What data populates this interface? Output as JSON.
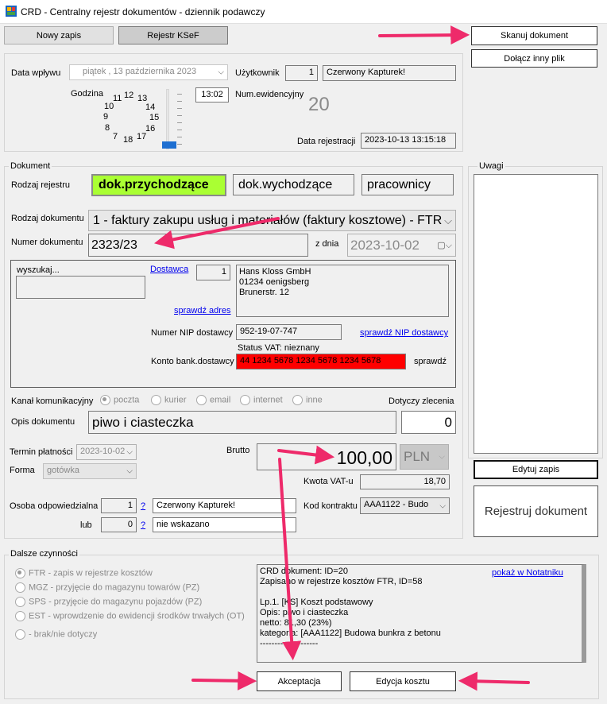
{
  "window": {
    "title": "CRD - Centralny rejestr dokumentów - dziennik podawczy"
  },
  "toolbar": {
    "new_entry": "Nowy zapis",
    "ksef": "Rejestr KSeF",
    "scan": "Skanuj dokument",
    "attach": "Dołącz inny plik"
  },
  "receipt": {
    "date_label": "Data wpływu",
    "date_value": "piątek     , 13 października 2023",
    "user_label": "Użytkownik",
    "user_id": "1",
    "user_name": "Czerwony Kapturek!",
    "hour_label": "Godzina",
    "time_value": "13:02",
    "evid_label": "Num.ewidencyjny",
    "evid_value": "20",
    "regdate_label": "Data rejestracji",
    "regdate_value": "2023-10-13 13:15:18",
    "clock": [
      "11",
      "12",
      "13",
      "10",
      "14",
      "9",
      "15",
      "8",
      "16",
      "7",
      "18",
      "17"
    ]
  },
  "document": {
    "group_title": "Dokument",
    "register_type_label": "Rodzaj rejestru",
    "register_types": [
      "dok.przychodzące",
      "dok.wychodzące",
      "pracownicy"
    ],
    "doc_type_label": "Rodzaj dokumentu",
    "doc_type_value": "1 - faktury zakupu usług i materiałów (faktury kosztowe) - FTR",
    "doc_number_label": "Numer dokumentu",
    "doc_number_value": "2323/23",
    "date_from_label": "z dnia",
    "date_from_value": "2023-10-02"
  },
  "supplier": {
    "search_label": "wyszukaj...",
    "supplier_link": "Dostawca",
    "supplier_id": "1",
    "address": [
      "Hans Kloss GmbH",
      "01234  oenigsberg",
      "Brunerstr. 12"
    ],
    "check_address": "sprawdź adres",
    "nip_label": "Numer NIP dostawcy",
    "nip_value": "952-19-07-747",
    "check_nip": "sprawdź NIP dostawcy",
    "vat_status": "Status VAT: nieznany",
    "bank_label": "Konto bank.dostawcy",
    "bank_value": "44 1234 5678 1234 5678 1234 5678",
    "check": "sprawdź"
  },
  "channel": {
    "label": "Kanał komunikacyjny",
    "options": [
      "poczta",
      "kurier",
      "email",
      "internet",
      "inne"
    ],
    "order_label": "Dotyczy zlecenia"
  },
  "description": {
    "label": "Opis dokumentu",
    "value": "piwo i ciasteczka",
    "order_value": "0"
  },
  "payment": {
    "due_label": "Termin płatności",
    "due_value": "2023-10-02",
    "form_label": "Forma",
    "form_value": "gotówka",
    "gross_label": "Brutto",
    "gross_value": "100,00",
    "currency": "PLN",
    "vat_label": "Kwota VAT-u",
    "vat_value": "18,70"
  },
  "responsible": {
    "label": "Osoba odpowiedzialna",
    "id1": "1",
    "q": "?",
    "name1": "Czerwony Kapturek!",
    "or_label": "lub",
    "id2": "0",
    "name2": "nie wskazano",
    "contract_label": "Kod kontraktu",
    "contract_value": "AAA1122     - Budo"
  },
  "notes": {
    "label": "Uwagi",
    "edit_button": "Edytuj zapis",
    "register_button": "Rejestruj dokument"
  },
  "further": {
    "group_title": "Dalsze czynności",
    "options": [
      "FTR - zapis w rejestrze kosztów",
      "MGZ - przyjęcie do magazynu towarów (PZ)",
      "SPS - przyjęcie do magazynu pojazdów (PZ)",
      "EST - wprowdzenie do ewidencji środków trwałych (OT)",
      "- brak/nie dotyczy"
    ],
    "log_lines": [
      "CRD dokument: ID=20",
      "Zapisano w rejestrze kosztów FTR, ID=58",
      "",
      "Lp.1. [KS] Koszt podstawowy",
      "Opis: piwo i ciasteczka",
      "netto: 81,30 (23%)",
      "kategoria: [AAA1122] Budowa bunkra z betonu",
      "--------------------"
    ],
    "notepad_link": "pokaż w Notatniku",
    "accept_button": "Akceptacja",
    "edit_cost_button": "Edycja kosztu"
  },
  "colors": {
    "accent_green": "#aaff33",
    "alert_red": "#ff0000",
    "arrow_pink": "#ee2a6a"
  }
}
